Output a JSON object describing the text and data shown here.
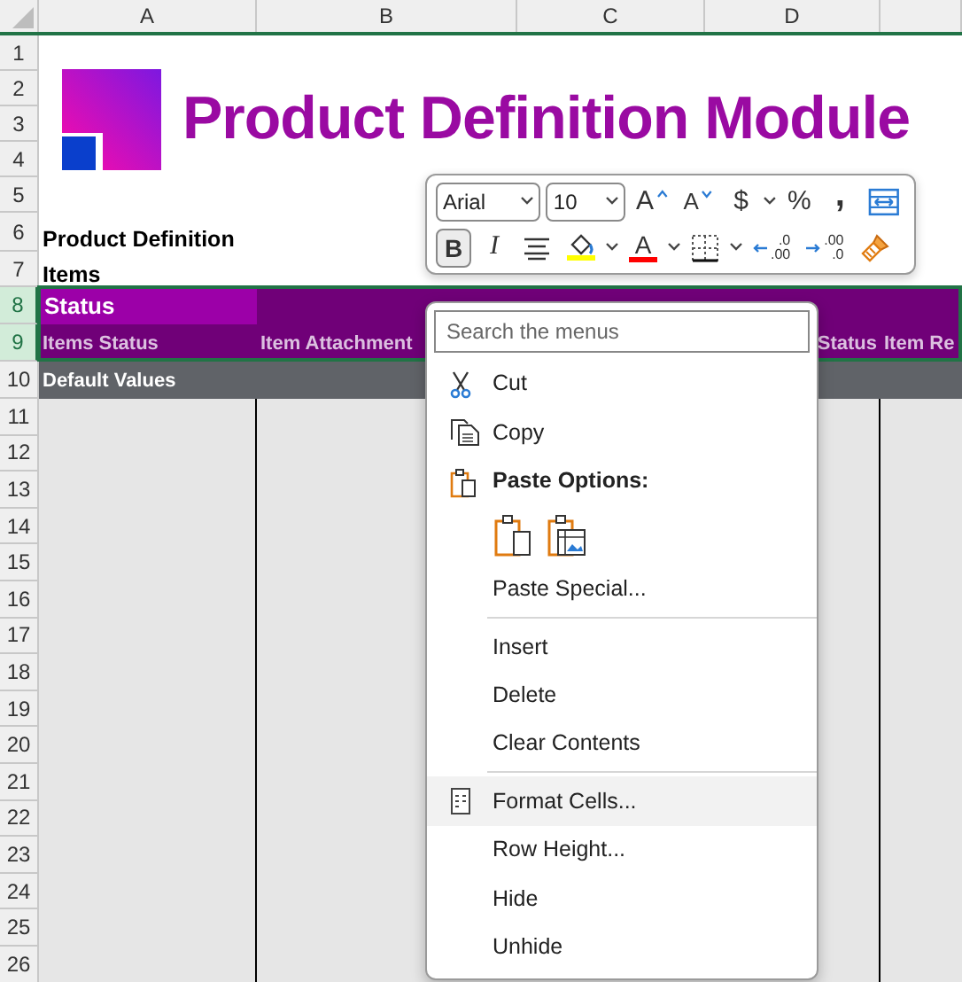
{
  "sheet": {
    "columns": [
      {
        "label": "A"
      },
      {
        "label": "B"
      },
      {
        "label": "C"
      },
      {
        "label": "D"
      }
    ],
    "rows": [
      {
        "label": "1",
        "selected": false
      },
      {
        "label": "2",
        "selected": false
      },
      {
        "label": "3",
        "selected": false
      },
      {
        "label": "4",
        "selected": false
      },
      {
        "label": "5",
        "selected": false
      },
      {
        "label": "6",
        "selected": false
      },
      {
        "label": "7",
        "selected": false
      },
      {
        "label": "8",
        "selected": true
      },
      {
        "label": "9",
        "selected": true
      },
      {
        "label": "10",
        "selected": false
      },
      {
        "label": "11",
        "selected": false
      },
      {
        "label": "12",
        "selected": false
      },
      {
        "label": "13",
        "selected": false
      },
      {
        "label": "14",
        "selected": false
      },
      {
        "label": "15",
        "selected": false
      },
      {
        "label": "16",
        "selected": false
      },
      {
        "label": "17",
        "selected": false
      },
      {
        "label": "18",
        "selected": false
      },
      {
        "label": "19",
        "selected": false
      },
      {
        "label": "20",
        "selected": false
      },
      {
        "label": "21",
        "selected": false
      },
      {
        "label": "22",
        "selected": false
      },
      {
        "label": "23",
        "selected": false
      },
      {
        "label": "24",
        "selected": false
      },
      {
        "label": "25",
        "selected": false
      },
      {
        "label": "26",
        "selected": false
      }
    ]
  },
  "title": "Product Definition Module",
  "labels": [
    "Product Definition",
    "Items"
  ],
  "section_header": "Status",
  "column_headers": [
    {
      "text": "Items Status"
    },
    {
      "text": "Item Attachment"
    },
    {
      "text": "Status"
    },
    {
      "text": "Item Re"
    }
  ],
  "default_values": "Default Values",
  "mini_toolbar": {
    "font": "Arial",
    "size": "10",
    "row1": [
      {
        "kind": "grow",
        "glyph": "A",
        "dropdown": false
      },
      {
        "kind": "shrink",
        "glyph": "A",
        "dropdown": false
      },
      {
        "kind": "glyph",
        "glyph": "$",
        "dropdown": true
      },
      {
        "kind": "glyph",
        "glyph": "%",
        "dropdown": false
      },
      {
        "kind": "glyph",
        "glyph": ",",
        "dropdown": false
      },
      {
        "kind": "wrap",
        "dropdown": false
      }
    ],
    "row2": [
      {
        "kind": "bold",
        "glyph": "B",
        "selected": true,
        "dropdown": false
      },
      {
        "kind": "italic",
        "glyph": "I",
        "selected": false,
        "dropdown": false
      },
      {
        "kind": "align",
        "dropdown": false
      },
      {
        "kind": "fill",
        "color": "#ffff00",
        "dropdown": true
      },
      {
        "kind": "fontcolor",
        "glyph": "A",
        "color": "#ff0000",
        "dropdown": true
      },
      {
        "kind": "borders",
        "dropdown": true
      },
      {
        "kind": "decimal-up",
        "top": ".0",
        "bottom": ".00",
        "dropdown": false
      },
      {
        "kind": "decimal-down",
        "top": ".00",
        "bottom": ".0",
        "dropdown": false
      },
      {
        "kind": "painter",
        "dropdown": false
      }
    ]
  },
  "context_menu": {
    "search_placeholder": "Search the menus",
    "items": [
      {
        "kind": "cut",
        "label": "Cut",
        "highlighted": false
      },
      {
        "kind": "copy",
        "label": "Copy",
        "highlighted": false
      },
      {
        "kind": "paste-heading",
        "label": "Paste Options:"
      },
      {
        "kind": "paste-buttons"
      },
      {
        "kind": "plain",
        "label": "Paste Special...",
        "highlighted": false
      },
      {
        "kind": "divider"
      },
      {
        "kind": "plain",
        "label": "Insert",
        "highlighted": false
      },
      {
        "kind": "plain",
        "label": "Delete",
        "highlighted": false
      },
      {
        "kind": "plain",
        "label": "Clear Contents",
        "highlighted": false
      },
      {
        "kind": "divider"
      },
      {
        "kind": "format",
        "label": "Format Cells...",
        "highlighted": true
      },
      {
        "kind": "plain",
        "label": "Row Height...",
        "highlighted": false
      },
      {
        "kind": "plain",
        "label": "Hide",
        "highlighted": false
      },
      {
        "kind": "plain",
        "label": "Unhide",
        "highlighted": false
      }
    ]
  }
}
